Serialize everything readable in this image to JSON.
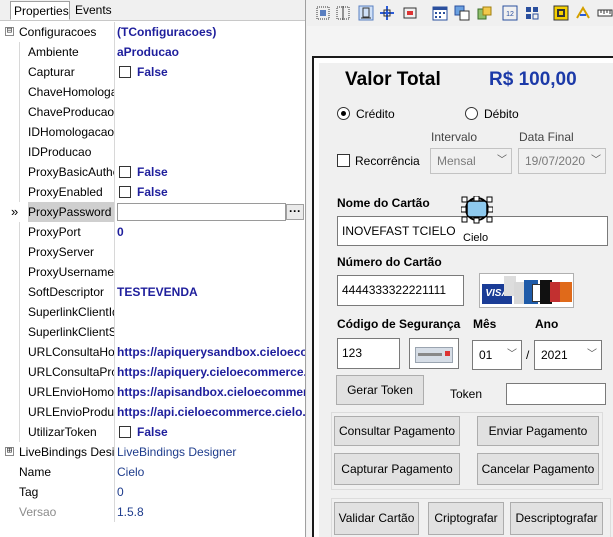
{
  "inspector": {
    "tabs": [
      "Properties",
      "Events"
    ],
    "rows": [
      {
        "name": "Configuracoes",
        "value": "(TConfiguracoes)",
        "kind": "text-bold",
        "expander": "⊟"
      },
      {
        "name": "Ambiente",
        "value": "aProducao",
        "kind": "text-bold"
      },
      {
        "name": "Capturar",
        "value": "False",
        "kind": "check"
      },
      {
        "name": "ChaveHomologacao",
        "value": "",
        "kind": "text"
      },
      {
        "name": "ChaveProducao",
        "value": "",
        "kind": "text"
      },
      {
        "name": "IDHomologacao",
        "value": "",
        "kind": "text"
      },
      {
        "name": "IDProducao",
        "value": "",
        "kind": "text"
      },
      {
        "name": "ProxyBasicAuthentication",
        "value": "False",
        "kind": "check"
      },
      {
        "name": "ProxyEnabled",
        "value": "False",
        "kind": "check"
      },
      {
        "name": "ProxyPassword",
        "value": "",
        "kind": "selected",
        "pointer": "»",
        "ellipsis": "···"
      },
      {
        "name": "ProxyPort",
        "value": "0",
        "kind": "text-bold"
      },
      {
        "name": "ProxyServer",
        "value": "",
        "kind": "text"
      },
      {
        "name": "ProxyUsername",
        "value": "",
        "kind": "text"
      },
      {
        "name": "SoftDescriptor",
        "value": "TESTEVENDA",
        "kind": "text-bold"
      },
      {
        "name": "SuperlinkClientId",
        "value": "",
        "kind": "text"
      },
      {
        "name": "SuperlinkClientSecret",
        "value": "",
        "kind": "text"
      },
      {
        "name": "URLConsultaHomologacao",
        "value": "https://apiquerysandbox.cieloecommerce",
        "kind": "text-bold"
      },
      {
        "name": "URLConsultaProducao",
        "value": "https://apiquery.cieloecommerce.cielo.com",
        "kind": "text-bold"
      },
      {
        "name": "URLEnvioHomologacao",
        "value": "https://apisandbox.cieloecommerce.cielo",
        "kind": "text-bold"
      },
      {
        "name": "URLEnvioProducao",
        "value": "https://api.cieloecommerce.cielo.com.br",
        "kind": "text-bold"
      },
      {
        "name": "UtilizarToken",
        "value": "False",
        "kind": "check"
      },
      {
        "name": "LiveBindings Designer",
        "value": "LiveBindings Designer",
        "kind": "text-plain",
        "expander": "⊞",
        "top": true
      },
      {
        "name": "Name",
        "value": "Cielo",
        "kind": "text-plain",
        "top": true
      },
      {
        "name": "Tag",
        "value": "0",
        "kind": "text-plain",
        "top": true
      },
      {
        "name": "Versao",
        "value": "1.5.8",
        "kind": "text-plain",
        "top": true,
        "disabled": true
      }
    ]
  },
  "toolbar": {
    "icons": [
      "align-left-icon",
      "align-center-icon",
      "align-to-grid-icon",
      "size-to-grid-icon",
      "center-horizontally-icon",
      "calendar-icon",
      "bring-to-front-icon",
      "send-to-back-icon",
      "tab-order-icon",
      "creation-order-icon",
      "lock-controls-icon",
      "flip-children-icon",
      "ruler-icon"
    ]
  },
  "form": {
    "total_label": "Valor Total",
    "total_value": "R$ 100,00",
    "credit_label": "Crédito",
    "debit_label": "Débito",
    "recurrence_label": "Recorrência",
    "interval_label": "Intervalo",
    "interval_value": "Mensal",
    "end_date_label": "Data Final",
    "end_date_value": "19/07/2020",
    "card_name_label": "Nome do Cartão",
    "card_name_value": "INOVEFAST TCIELO",
    "component_caption": "Cielo",
    "card_number_label": "Número do Cartão",
    "card_number_value": "4444333322221111",
    "brand_visa": "VISA",
    "security_code_label": "Código de Segurança",
    "security_code_value": "123",
    "month_label": "Mês",
    "month_value": "01",
    "year_label": "Ano",
    "year_value": "2021",
    "date_separator": "/",
    "generate_token_label": "Gerar Token",
    "token_label": "Token",
    "token_value": "",
    "consult_payment_label": "Consultar Pagamento",
    "send_payment_label": "Enviar Pagamento",
    "capture_payment_label": "Capturar Pagamento",
    "cancel_payment_label": "Cancelar Pagamento",
    "validate_card_label": "Validar Cartão",
    "encrypt_label": "Criptografar",
    "decrypt_label": "Descriptografar"
  },
  "colors": {
    "value_blue": "#1e1e9c",
    "total_blue": "#1c3aa8"
  }
}
